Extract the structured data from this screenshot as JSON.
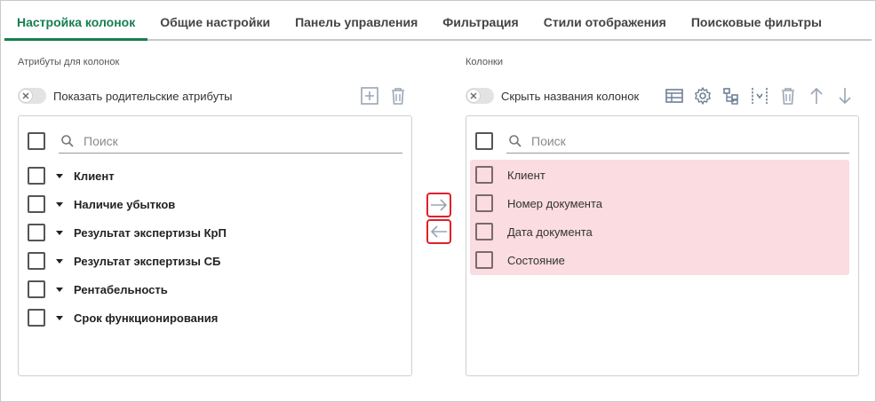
{
  "tabs": [
    {
      "label": "Настройка колонок",
      "active": true
    },
    {
      "label": "Общие настройки",
      "active": false
    },
    {
      "label": "Панель управления",
      "active": false
    },
    {
      "label": "Фильтрация",
      "active": false
    },
    {
      "label": "Стили отображения",
      "active": false
    },
    {
      "label": "Поисковые фильтры",
      "active": false
    }
  ],
  "left": {
    "title": "Атрибуты для колонок",
    "toggle_label": "Показать родительские атрибуты",
    "search_placeholder": "Поиск",
    "items": [
      {
        "label": "Клиент"
      },
      {
        "label": "Наличие убытков"
      },
      {
        "label": "Результат экспертизы КрП"
      },
      {
        "label": "Результат экспертизы СБ"
      },
      {
        "label": "Рентабельность"
      },
      {
        "label": "Срок функционирования"
      }
    ]
  },
  "right": {
    "title": "Колонки",
    "toggle_label": "Скрыть названия колонок",
    "search_placeholder": "Поиск",
    "items": [
      {
        "label": "Клиент"
      },
      {
        "label": "Номер документа"
      },
      {
        "label": "Дата документа"
      },
      {
        "label": "Состояние"
      }
    ]
  },
  "colors": {
    "accent": "#177d52",
    "highlight_row": "#fbdce0",
    "move_border": "#e0202c",
    "icon": "#9aa5b4"
  },
  "icons": {
    "left_toolbar": [
      "add-square-icon",
      "trash-icon"
    ],
    "right_toolbar": [
      "table-icon",
      "gear-icon",
      "hierarchy-icon",
      "column-split-icon",
      "trash-icon",
      "arrow-up-icon",
      "arrow-down-icon"
    ],
    "move": [
      "arrow-right-icon",
      "arrow-left-icon"
    ]
  }
}
